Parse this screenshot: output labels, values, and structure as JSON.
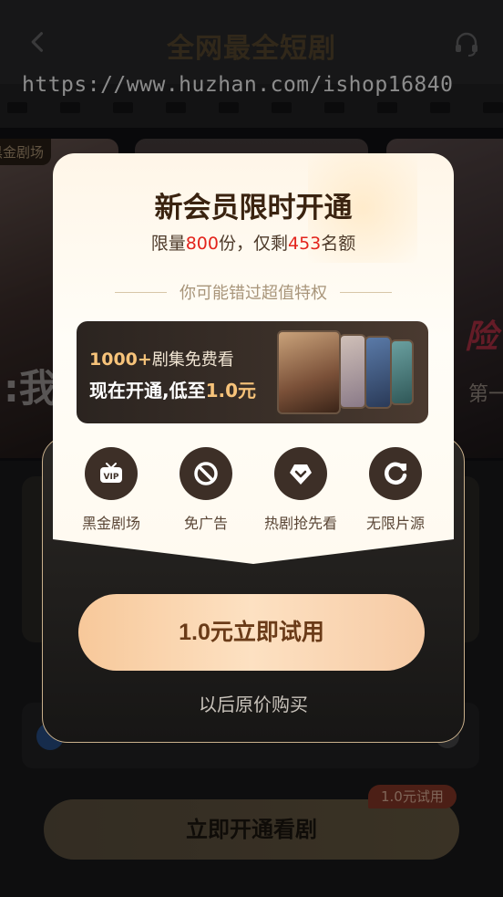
{
  "header": {
    "title": "全网最全短剧",
    "back_icon": "chevron-left-icon",
    "service_icon": "headset-icon"
  },
  "watermark": "https://www.huzhan.com/ishop16840",
  "posters": {
    "left_tag": "黑金剧场",
    "left_text": ":我",
    "right_text": "险",
    "right_sub": "第一"
  },
  "background": {
    "cta_label": "立即开通看剧",
    "trial_badge": "1.0元试用"
  },
  "modal": {
    "title": "新会员限时开通",
    "subtitle_prefix": "限量",
    "limit_count": "800",
    "subtitle_mid": "份，仅剩",
    "remaining_count": "453",
    "subtitle_suffix": "名额",
    "divider_text": "你可能错过超值特权",
    "banner": {
      "count": "1000+",
      "line1_rest": "剧集免费看",
      "line2_prefix": "现在开通,低至",
      "line2_price": "1.0元"
    },
    "perks": [
      {
        "label": "黑金剧场",
        "icon": "vip-tv-icon"
      },
      {
        "label": "免广告",
        "icon": "no-ads-icon"
      },
      {
        "label": "热剧抢先看",
        "icon": "heart-badge-icon"
      },
      {
        "label": "无限片源",
        "icon": "refresh-icon"
      }
    ],
    "primary_button": "1.0元立即试用",
    "secondary_link": "以后原价购买"
  },
  "colors": {
    "accent_red": "#e3241c",
    "gold": "#f7c37a",
    "button_gradient_start": "#f7c89a",
    "button_text": "#6a3b18"
  }
}
